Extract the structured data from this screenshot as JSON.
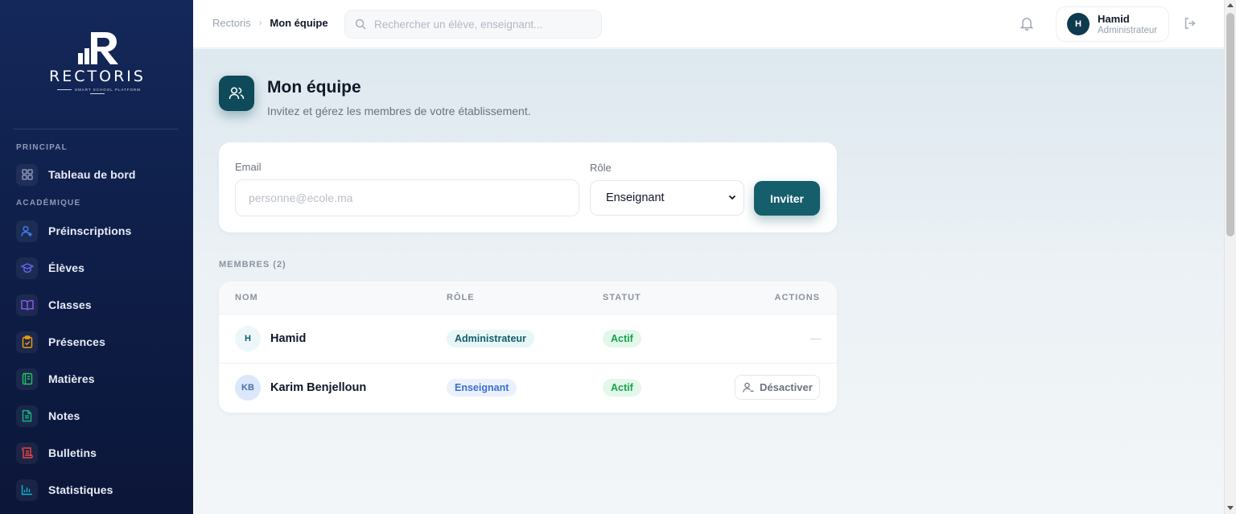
{
  "brand": {
    "name": "RECTORIS",
    "tagline": "SMART SCHOOL PLATFORM"
  },
  "sidebar": {
    "sections": [
      {
        "label": "PRINCIPAL"
      },
      {
        "label": "ACADÉMIQUE"
      }
    ],
    "items": [
      {
        "label": "Tableau de bord",
        "icon": "dashboard-grid-icon",
        "color": "#9aa6c4"
      },
      {
        "label": "Préinscriptions",
        "icon": "user-plus-icon",
        "color": "#3b82f6"
      },
      {
        "label": "Élèves",
        "icon": "graduation-cap-icon",
        "color": "#6366f1"
      },
      {
        "label": "Classes",
        "icon": "book-open-icon",
        "color": "#8b5cf6"
      },
      {
        "label": "Présences",
        "icon": "clipboard-check-icon",
        "color": "#f59e0b"
      },
      {
        "label": "Matières",
        "icon": "notebook-icon",
        "color": "#22c55e"
      },
      {
        "label": "Notes",
        "icon": "file-text-icon",
        "color": "#10b981"
      },
      {
        "label": "Bulletins",
        "icon": "scroll-icon",
        "color": "#ef4444"
      },
      {
        "label": "Statistiques",
        "icon": "bar-chart-icon",
        "color": "#06b6d4"
      }
    ]
  },
  "topbar": {
    "breadcrumb_root": "Rectoris",
    "breadcrumb_current": "Mon équipe",
    "search_placeholder": "Rechercher un élève, enseignant...",
    "user": {
      "initial": "H",
      "name": "Hamid",
      "role": "Administrateur"
    }
  },
  "page": {
    "title": "Mon équipe",
    "subtitle": "Invitez et gérez les membres de votre établissement."
  },
  "invite": {
    "email_label": "Email",
    "email_placeholder": "personne@ecole.ma",
    "email_value": "",
    "role_label": "Rôle",
    "role_value": "Enseignant",
    "submit_label": "Inviter"
  },
  "members": {
    "label": "MEMBRES (2)",
    "columns": [
      "NOM",
      "RÔLE",
      "STATUT",
      "ACTIONS"
    ],
    "rows": [
      {
        "initials": "H",
        "name": "Hamid",
        "role": "Administrateur",
        "status": "Actif",
        "action": "—"
      },
      {
        "initials": "KB",
        "name": "Karim Benjelloun",
        "role": "Enseignant",
        "status": "Actif",
        "action": "Désactiver"
      }
    ]
  },
  "colors": {
    "accent": "#155e6b",
    "sidebar_bg": "#14285a",
    "status_active": "#16a34a"
  }
}
